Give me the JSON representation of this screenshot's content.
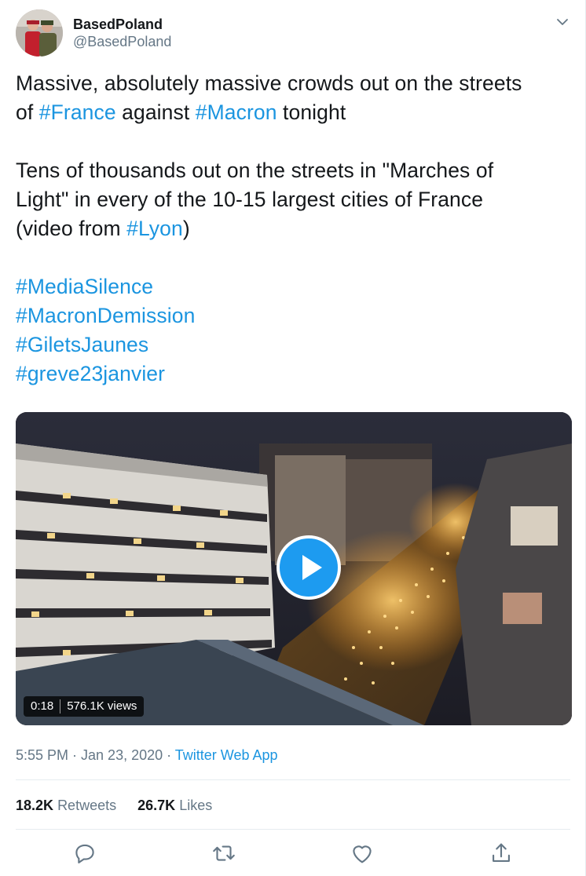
{
  "author": {
    "display_name": "BasedPoland",
    "handle": "@BasedPoland"
  },
  "tweet": {
    "line1": "Massive, absolutely massive crowds out on the streets",
    "line2_pre": "of ",
    "tag_france": "#France",
    "line2_mid": " against ",
    "tag_macron": "#Macron",
    "line2_post": " tonight",
    "line3": "Tens of thousands out on the streets in \"Marches of",
    "line4": "Light\" in every of the 10-15 largest cities of France",
    "line5_pre": "(video from ",
    "tag_lyon": "#Lyon",
    "line5_post": ")",
    "hashtags": [
      "#MediaSilence",
      "#MacronDemission",
      "#GiletsJaunes",
      "#greve23janvier"
    ]
  },
  "video": {
    "duration": "0:18",
    "views": "576.1K views"
  },
  "meta": {
    "time": "5:55 PM · Jan 23, 2020 · ",
    "source": "Twitter Web App"
  },
  "stats": {
    "retweets_count": "18.2K",
    "retweets_label": "Retweets",
    "likes_count": "26.7K",
    "likes_label": "Likes"
  },
  "icons": {
    "caret": "chevron-down-icon",
    "reply": "reply-icon",
    "retweet": "retweet-icon",
    "like": "heart-icon",
    "share": "share-icon",
    "play": "play-icon"
  },
  "colors": {
    "link": "#1b95e0",
    "secondary": "#657786",
    "play": "#1d9bf0"
  }
}
